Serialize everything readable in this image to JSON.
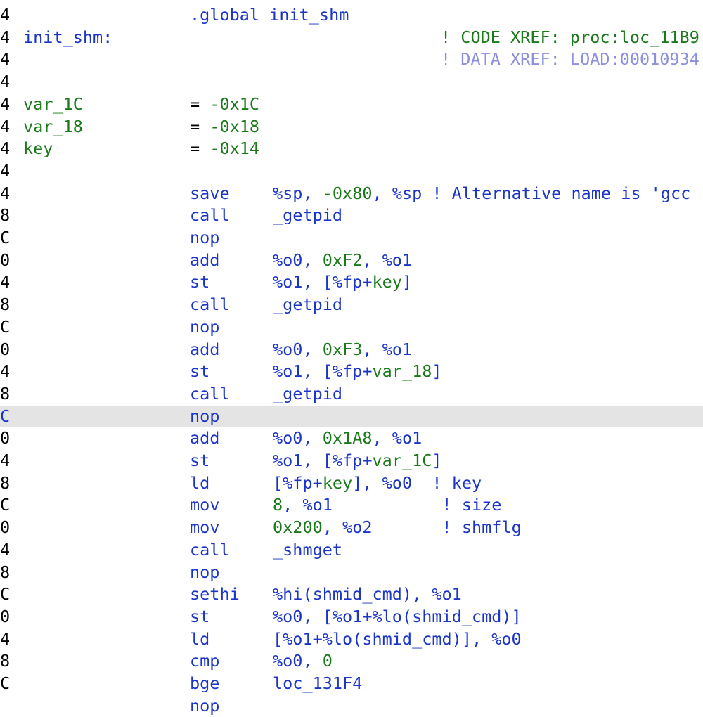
{
  "colors": {
    "text": "#000000",
    "keyword_green": "#1a7a1a",
    "operand_blue": "#1b35c8",
    "data_xref_light": "#8c8fe0",
    "selected_row_bg": "#e4e4e4",
    "background": "#ffffff"
  },
  "rows": [
    {
      "name": "row-global",
      "addr": "4",
      "label": [],
      "a": [
        {
          "t": ".global init_shm",
          "c": "b"
        }
      ],
      "b": [],
      "c": []
    },
    {
      "name": "row-function-label",
      "addr": "4",
      "label": [
        {
          "t": "init_shm:",
          "c": "b"
        }
      ],
      "a": [],
      "b": [],
      "c": [
        {
          "t": "! CODE XREF: proc:loc_11B9",
          "c": "g"
        }
      ]
    },
    {
      "name": "row-data-xref",
      "addr": "4",
      "label": [],
      "a": [],
      "b": [],
      "c": [
        {
          "t": "! DATA XREF: LOAD:00010934",
          "c": "l"
        }
      ]
    },
    {
      "name": "row-blank-1",
      "addr": "4",
      "label": [],
      "a": [],
      "b": [],
      "c": []
    },
    {
      "name": "row-var-1c",
      "addr": "4",
      "label": [
        {
          "t": "var_1C",
          "c": "g"
        }
      ],
      "a": [
        {
          "t": "= ",
          "c": "k"
        },
        {
          "t": "-0x1C",
          "c": "g"
        }
      ],
      "b": [],
      "c": []
    },
    {
      "name": "row-var-18",
      "addr": "4",
      "label": [
        {
          "t": "var_18",
          "c": "g"
        }
      ],
      "a": [
        {
          "t": "= ",
          "c": "k"
        },
        {
          "t": "-0x18",
          "c": "g"
        }
      ],
      "b": [],
      "c": []
    },
    {
      "name": "row-key",
      "addr": "4",
      "label": [
        {
          "t": "key",
          "c": "g"
        }
      ],
      "a": [
        {
          "t": "= ",
          "c": "k"
        },
        {
          "t": "-0x14",
          "c": "g"
        }
      ],
      "b": [],
      "c": []
    },
    {
      "name": "row-blank-2",
      "addr": "4",
      "label": [],
      "a": [],
      "b": [],
      "c": []
    },
    {
      "name": "row-save",
      "addr": "4",
      "label": [],
      "a": [
        {
          "t": "save",
          "c": "b"
        }
      ],
      "b": [
        {
          "t": "%sp, ",
          "c": "b"
        },
        {
          "t": "-0x80",
          "c": "g"
        },
        {
          "t": ", %sp ",
          "c": "b"
        },
        {
          "t": "! Alternative name is 'gcc",
          "c": "b"
        }
      ],
      "c": []
    },
    {
      "name": "row-call-getpid-1",
      "addr": "8",
      "label": [],
      "a": [
        {
          "t": "call",
          "c": "b"
        }
      ],
      "b": [
        {
          "t": "_getpid",
          "c": "b"
        }
      ],
      "c": []
    },
    {
      "name": "row-nop-1",
      "addr": "C",
      "label": [],
      "a": [
        {
          "t": "nop",
          "c": "b"
        }
      ],
      "b": [],
      "c": []
    },
    {
      "name": "row-add-f2",
      "addr": "0",
      "label": [],
      "a": [
        {
          "t": "add",
          "c": "b"
        }
      ],
      "b": [
        {
          "t": "%o0, ",
          "c": "b"
        },
        {
          "t": "0xF2",
          "c": "g"
        },
        {
          "t": ", %o1",
          "c": "b"
        }
      ],
      "c": []
    },
    {
      "name": "row-st-key",
      "addr": "4",
      "label": [],
      "a": [
        {
          "t": "st",
          "c": "b"
        }
      ],
      "b": [
        {
          "t": "%o1, [%fp+",
          "c": "b"
        },
        {
          "t": "key",
          "c": "g"
        },
        {
          "t": "]",
          "c": "b"
        }
      ],
      "c": []
    },
    {
      "name": "row-call-getpid-2",
      "addr": "8",
      "label": [],
      "a": [
        {
          "t": "call",
          "c": "b"
        }
      ],
      "b": [
        {
          "t": "_getpid",
          "c": "b"
        }
      ],
      "c": []
    },
    {
      "name": "row-nop-2",
      "addr": "C",
      "label": [],
      "a": [
        {
          "t": "nop",
          "c": "b"
        }
      ],
      "b": [],
      "c": []
    },
    {
      "name": "row-add-f3",
      "addr": "0",
      "label": [],
      "a": [
        {
          "t": "add",
          "c": "b"
        }
      ],
      "b": [
        {
          "t": "%o0, ",
          "c": "b"
        },
        {
          "t": "0xF3",
          "c": "g"
        },
        {
          "t": ", %o1",
          "c": "b"
        }
      ],
      "c": []
    },
    {
      "name": "row-st-var-18",
      "addr": "4",
      "label": [],
      "a": [
        {
          "t": "st",
          "c": "b"
        }
      ],
      "b": [
        {
          "t": "%o1, [%fp+",
          "c": "b"
        },
        {
          "t": "var_18",
          "c": "g"
        },
        {
          "t": "]",
          "c": "b"
        }
      ],
      "c": []
    },
    {
      "name": "row-call-getpid-3",
      "addr": "8",
      "label": [],
      "a": [
        {
          "t": "call",
          "c": "b"
        }
      ],
      "b": [
        {
          "t": "_getpid",
          "c": "b"
        }
      ],
      "c": []
    },
    {
      "name": "row-nop-3",
      "addr": "C",
      "selected": true,
      "label": [],
      "a": [
        {
          "t": "nop",
          "c": "b"
        }
      ],
      "b": [],
      "c": []
    },
    {
      "name": "row-add-1a8",
      "addr": "0",
      "label": [],
      "a": [
        {
          "t": "add",
          "c": "b"
        }
      ],
      "b": [
        {
          "t": "%o0, ",
          "c": "b"
        },
        {
          "t": "0x1A8",
          "c": "g"
        },
        {
          "t": ", %o1",
          "c": "b"
        }
      ],
      "c": []
    },
    {
      "name": "row-st-var-1c",
      "addr": "4",
      "label": [],
      "a": [
        {
          "t": "st",
          "c": "b"
        }
      ],
      "b": [
        {
          "t": "%o1, [%fp+",
          "c": "b"
        },
        {
          "t": "var_1C",
          "c": "g"
        },
        {
          "t": "]",
          "c": "b"
        }
      ],
      "c": []
    },
    {
      "name": "row-ld-key",
      "addr": "8",
      "label": [],
      "a": [
        {
          "t": "ld",
          "c": "b"
        }
      ],
      "b": [
        {
          "t": "[%fp+",
          "c": "b"
        },
        {
          "t": "key",
          "c": "g"
        },
        {
          "t": "], %o0  ! key",
          "c": "b"
        }
      ],
      "c": []
    },
    {
      "name": "row-mov-size",
      "addr": "C",
      "label": [],
      "a": [
        {
          "t": "mov",
          "c": "b"
        }
      ],
      "b": [
        {
          "t": "8",
          "c": "g"
        },
        {
          "t": ", %o1           ! size",
          "c": "b"
        }
      ],
      "c": []
    },
    {
      "name": "row-mov-shmflg",
      "addr": "0",
      "label": [],
      "a": [
        {
          "t": "mov",
          "c": "b"
        }
      ],
      "b": [
        {
          "t": "0x200",
          "c": "g"
        },
        {
          "t": ", %o2       ! shmflg",
          "c": "b"
        }
      ],
      "c": []
    },
    {
      "name": "row-call-shmget",
      "addr": "4",
      "label": [],
      "a": [
        {
          "t": "call",
          "c": "b"
        }
      ],
      "b": [
        {
          "t": "_shmget",
          "c": "b"
        }
      ],
      "c": []
    },
    {
      "name": "row-nop-4",
      "addr": "8",
      "label": [],
      "a": [
        {
          "t": "nop",
          "c": "b"
        }
      ],
      "b": [],
      "c": []
    },
    {
      "name": "row-sethi",
      "addr": "C",
      "label": [],
      "a": [
        {
          "t": "sethi",
          "c": "b"
        }
      ],
      "b": [
        {
          "t": "%hi(shmid_cmd), %o1",
          "c": "b"
        }
      ],
      "c": []
    },
    {
      "name": "row-st-shmid",
      "addr": "0",
      "label": [],
      "a": [
        {
          "t": "st",
          "c": "b"
        }
      ],
      "b": [
        {
          "t": "%o0, [%o1+%lo(shmid_cmd)]",
          "c": "b"
        }
      ],
      "c": []
    },
    {
      "name": "row-ld-shmid",
      "addr": "4",
      "label": [],
      "a": [
        {
          "t": "ld",
          "c": "b"
        }
      ],
      "b": [
        {
          "t": "[%o1+%lo(shmid_cmd)], %o0",
          "c": "b"
        }
      ],
      "c": []
    },
    {
      "name": "row-cmp",
      "addr": "8",
      "label": [],
      "a": [
        {
          "t": "cmp",
          "c": "b"
        }
      ],
      "b": [
        {
          "t": "%o0, ",
          "c": "b"
        },
        {
          "t": "0",
          "c": "g"
        }
      ],
      "c": []
    },
    {
      "name": "row-bge",
      "addr": "C",
      "label": [],
      "a": [
        {
          "t": "bge",
          "c": "b"
        }
      ],
      "b": [
        {
          "t": "loc_131F4",
          "c": "b"
        }
      ],
      "c": []
    },
    {
      "name": "row-nop-5",
      "addr": "",
      "label": [],
      "a": [
        {
          "t": "nop",
          "c": "b"
        }
      ],
      "b": [],
      "c": []
    }
  ]
}
